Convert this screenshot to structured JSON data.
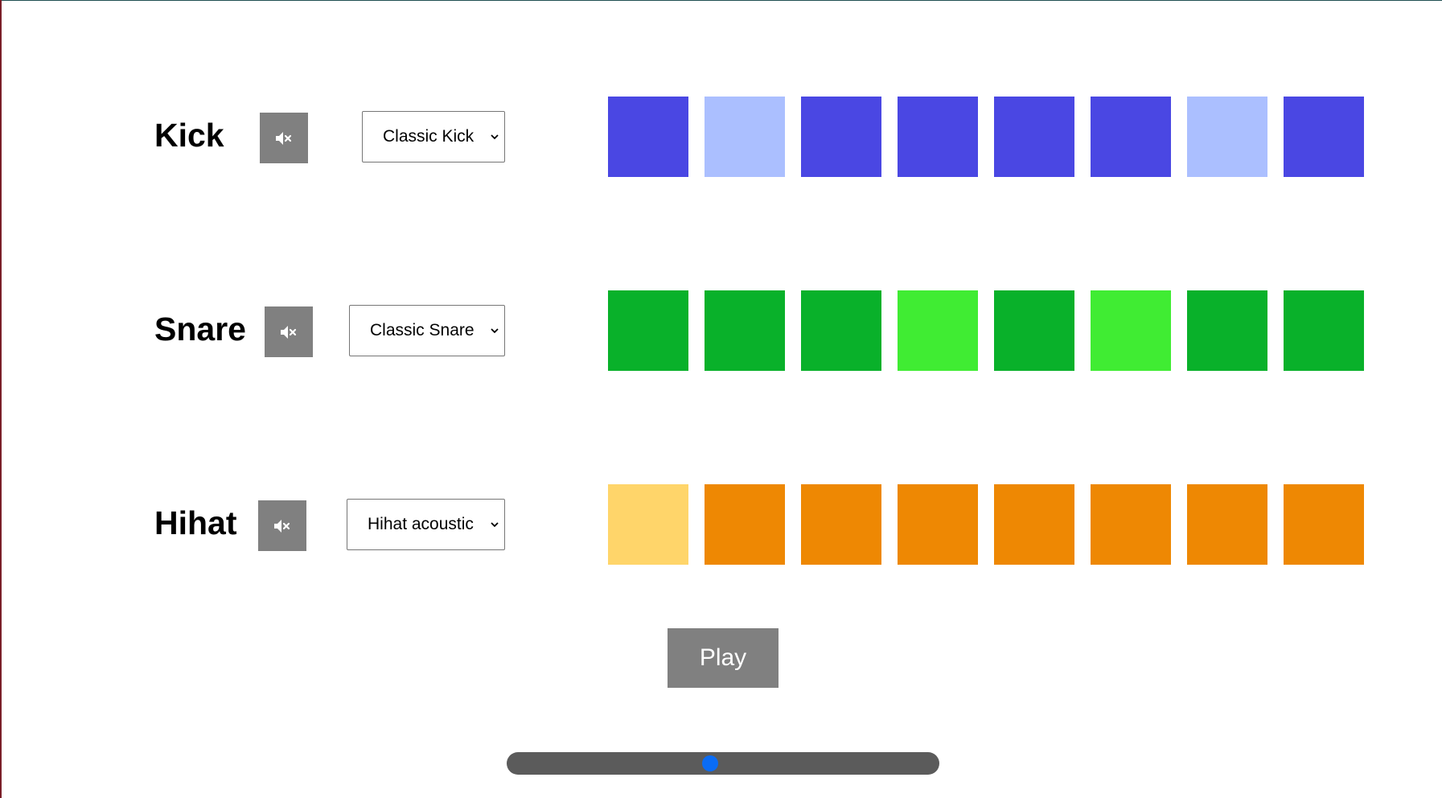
{
  "colors": {
    "kick_on": "#4a47e3",
    "kick_off": "#abbfff",
    "snare_on": "#09b12a",
    "snare_off": "#40ec33",
    "hihat_on": "#ee8803",
    "hihat_off": "#ffd56a",
    "button_bg": "#808080",
    "slider_track": "#5b5b5b",
    "slider_thumb": "#0a6cf5"
  },
  "tracks": [
    {
      "name": "Kick",
      "mute_icon": "speaker-muted-icon",
      "sound": "Classic Kick",
      "steps": [
        true,
        false,
        true,
        true,
        true,
        true,
        false,
        true
      ]
    },
    {
      "name": "Snare",
      "mute_icon": "speaker-muted-icon",
      "sound": "Classic Snare",
      "steps": [
        true,
        true,
        true,
        false,
        true,
        false,
        true,
        true
      ]
    },
    {
      "name": "Hihat",
      "mute_icon": "speaker-muted-icon",
      "sound": "Hihat acoustic",
      "steps": [
        false,
        true,
        true,
        true,
        true,
        true,
        true,
        true
      ]
    }
  ],
  "controls": {
    "play_label": "Play",
    "tempo_fraction": 0.47
  }
}
